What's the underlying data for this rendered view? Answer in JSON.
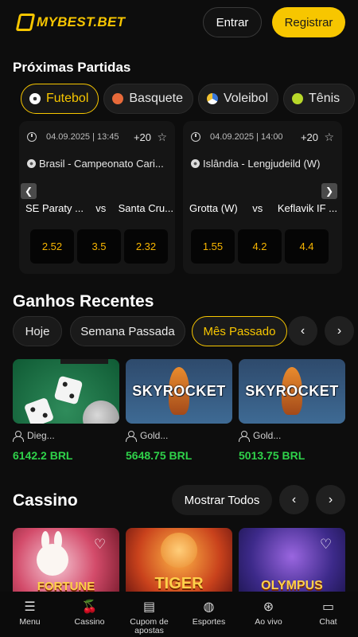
{
  "header": {
    "logo_text": "MYBEST.BET",
    "login_label": "Entrar",
    "register_label": "Registrar"
  },
  "upcoming": {
    "title": "Próximas Partidas",
    "sports": [
      {
        "label": "Futebol",
        "icon": "soccer-ball-icon",
        "active": true
      },
      {
        "label": "Basquete",
        "icon": "basketball-icon"
      },
      {
        "label": "Voleibol",
        "icon": "volleyball-icon"
      },
      {
        "label": "Tênis",
        "icon": "tennis-ball-icon"
      }
    ],
    "matches": [
      {
        "datetime": "04.09.2025 | 13:45",
        "more": "+20",
        "league": "Brasil - Campeonato Cari...",
        "home": "SE Paraty ...",
        "vs": "vs",
        "away": "Santa Cru...",
        "odds": [
          "2.52",
          "3.5",
          "2.32"
        ]
      },
      {
        "datetime": "04.09.2025 | 14:00",
        "more": "+20",
        "league": "Islândia - Lengjudeild (W)",
        "home": "Grotta (W)",
        "vs": "vs",
        "away": "Keflavik IF ...",
        "odds": [
          "1.55",
          "4.2",
          "4.4"
        ]
      }
    ]
  },
  "recent_wins": {
    "title": "Ganhos Recentes",
    "periods": [
      {
        "label": "Hoje"
      },
      {
        "label": "Semana Passada"
      },
      {
        "label": "Mês Passado",
        "active": true
      }
    ],
    "items": [
      {
        "user": "Dieg...",
        "amount": "6142.2 BRL",
        "game": "dice"
      },
      {
        "user": "Gold...",
        "amount": "5648.75 BRL",
        "game": "SKYROCKET"
      },
      {
        "user": "Gold...",
        "amount": "5013.75 BRL",
        "game": "SKYROCKET"
      }
    ]
  },
  "casino": {
    "title": "Cassino",
    "show_all_label": "Mostrar Todos",
    "games": [
      {
        "name": "Fortune Rabbit",
        "art_text": "FORTUNE"
      },
      {
        "name": "Fortune Tiger",
        "art_text": "TIGER"
      },
      {
        "name": "Gates of Olympus",
        "art_text": "OLYMPUS"
      }
    ]
  },
  "bottom_nav": [
    {
      "label": "Menu",
      "icon": "menu-icon"
    },
    {
      "label": "Cassino",
      "icon": "cherries-icon"
    },
    {
      "label": "Cupom de apostas",
      "icon": "betslip-icon"
    },
    {
      "label": "Esportes",
      "icon": "basketball-icon"
    },
    {
      "label": "Ao vivo",
      "icon": "live-icon"
    },
    {
      "label": "Chat",
      "icon": "chat-icon"
    }
  ],
  "colors": {
    "accent": "#f7c600",
    "odds": "#f7b500",
    "win": "#2fd24a",
    "background": "#0d0d0d"
  }
}
